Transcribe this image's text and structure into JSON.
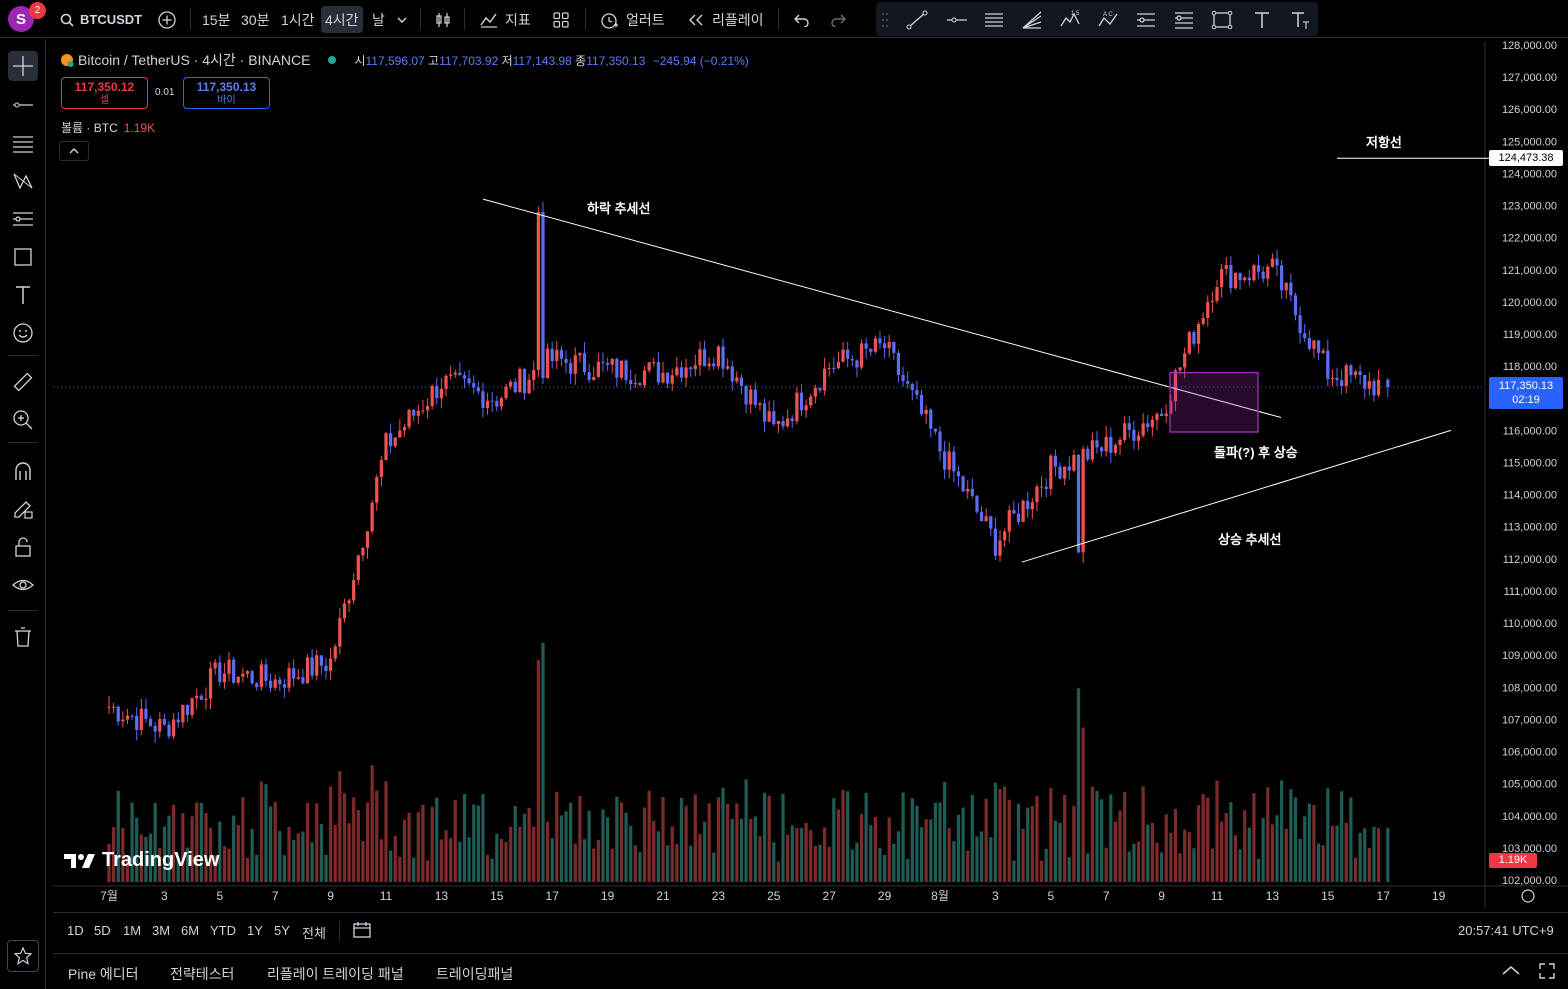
{
  "topbar": {
    "avatar_letter": "S",
    "notification_count": "2",
    "symbol": "BTCUSDT",
    "intervals": [
      "15분",
      "30분",
      "1시간",
      "4시간",
      "날"
    ],
    "active_interval": "4시간",
    "indicators_label": "지표",
    "alert_label": "얼러트",
    "replay_label": "리플레이"
  },
  "legend": {
    "title": "Bitcoin / TetherUS · 4시간 · BINANCE",
    "open_key": "시",
    "open": "117,596.07",
    "high_key": "고",
    "high": "117,703.92",
    "low_key": "저",
    "low": "117,143.98",
    "close_key": "종",
    "close": "117,350.13",
    "change": "−245.94 (−0.21%)"
  },
  "trade": {
    "sell_price": "117,350.12",
    "sell_label": "셀",
    "spread": "0.01",
    "buy_price": "117,350.13",
    "buy_label": "바이"
  },
  "volume_legend": {
    "label": "볼륨 · BTC",
    "value": "1.19K"
  },
  "annotations": {
    "down_trend": "하락 추세선",
    "up_trend": "상승 추세선",
    "breakout": "돌파(?) 후 상승",
    "resistance": "저항선"
  },
  "price_scale": {
    "ticks": [
      "128,000.00",
      "127,000.00",
      "126,000.00",
      "125,000.00",
      "124,000.00",
      "123,000.00",
      "122,000.00",
      "121,000.00",
      "120,000.00",
      "119,000.00",
      "118,000.00",
      "117,000.00",
      "116,000.00",
      "115,000.00",
      "114,000.00",
      "113,000.00",
      "112,000.00",
      "111,000.00",
      "110,000.00",
      "109,000.00",
      "108,000.00",
      "107,000.00",
      "106,000.00",
      "105,000.00",
      "104,000.00",
      "103,000.00",
      "102,000.00"
    ],
    "resistance_price": "124,473.38",
    "current_price": "117,350.13",
    "countdown": "02:19",
    "volume_tag": "1.19K"
  },
  "time_scale": [
    "7월",
    "3",
    "5",
    "7",
    "9",
    "11",
    "13",
    "15",
    "17",
    "19",
    "21",
    "23",
    "25",
    "27",
    "29",
    "8월",
    "3",
    "5",
    "7",
    "9",
    "11",
    "13",
    "15",
    "17",
    "19"
  ],
  "branding": "TradingView",
  "range_buttons": [
    "1D",
    "5D",
    "1M",
    "3M",
    "6M",
    "YTD",
    "1Y",
    "5Y",
    "전체"
  ],
  "clock": "20:57:41 UTC+9",
  "bottom_tabs": [
    "Pine 에디터",
    "전략테스터",
    "리플레이 트레이딩 패널",
    "트레이딩패널"
  ],
  "colors": {
    "up": "#ef5350",
    "down": "#5b6cf5",
    "vol_up": "#7d2a2a",
    "vol_down": "#1e5c55",
    "background": "#000000",
    "box": "#9c27b0"
  },
  "chart_data": {
    "type": "candlestick",
    "ylim": [
      102000,
      128000
    ],
    "x": [
      "7월",
      "3",
      "5",
      "7",
      "9",
      "11",
      "13",
      "15",
      "17",
      "19",
      "21",
      "23",
      "25",
      "27",
      "29",
      "8월",
      "3",
      "5",
      "7",
      "9",
      "11",
      "13",
      "15",
      "17"
    ],
    "anchors": [
      {
        "x": "7월",
        "close": 107400
      },
      {
        "x": "3",
        "close": 106700
      },
      {
        "x": "5",
        "close": 108500
      },
      {
        "x": "7",
        "close": 108200
      },
      {
        "x": "9",
        "close": 108800
      },
      {
        "x": "11",
        "close": 115500
      },
      {
        "x": "13",
        "close": 117500
      },
      {
        "x": "15",
        "close": 117000
      },
      {
        "x": "17",
        "close": 118200
      },
      {
        "x": "19",
        "close": 117900
      },
      {
        "x": "21",
        "close": 117800
      },
      {
        "x": "23",
        "close": 118500
      },
      {
        "x": "25",
        "close": 116000
      },
      {
        "x": "27",
        "close": 118000
      },
      {
        "x": "29",
        "close": 118600
      },
      {
        "x": "8월",
        "close": 115400
      },
      {
        "x": "3",
        "close": 112500
      },
      {
        "x": "5",
        "close": 114800
      },
      {
        "x": "7",
        "close": 115500
      },
      {
        "x": "9",
        "close": 116600
      },
      {
        "x": "11",
        "close": 120800
      },
      {
        "x": "13",
        "close": 121000
      },
      {
        "x": "15",
        "close": 117800
      },
      {
        "x": "17",
        "close": 117350
      }
    ],
    "peaks": [
      {
        "label": "14",
        "high": 123200
      },
      {
        "label": "14 (8월)",
        "high": 124473.38
      }
    ],
    "lows": [
      {
        "label": "3 (8월)",
        "low": 111900
      }
    ],
    "trendlines": [
      {
        "name": "하락 추세선",
        "from": {
          "x": "14 (7월)",
          "y": 123200
        },
        "to": {
          "x": "12 (8월)",
          "y": 116400
        }
      },
      {
        "name": "상승 추세선",
        "from": {
          "x": "3 (8월)",
          "y": 111900
        },
        "to": {
          "x": "18 (8월)",
          "y": 116000
        }
      }
    ],
    "resistance_level": 124473.38,
    "current_close": 117350.13,
    "volume_last": "1.19K"
  }
}
